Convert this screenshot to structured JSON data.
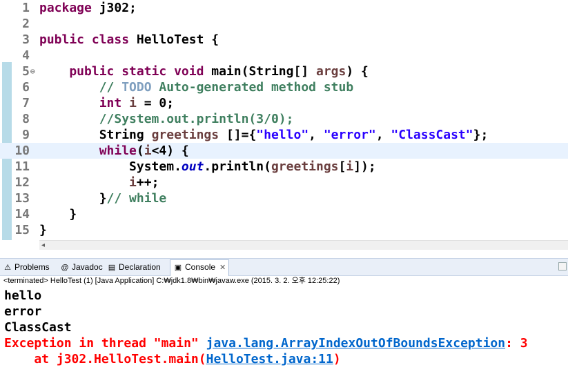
{
  "editor": {
    "lines": [
      {
        "n": "1",
        "tokens": [
          {
            "c": "kw",
            "t": "package"
          },
          {
            "c": "plain",
            "t": " j302;"
          }
        ]
      },
      {
        "n": "2",
        "tokens": []
      },
      {
        "n": "3",
        "tokens": [
          {
            "c": "kw",
            "t": "public class"
          },
          {
            "c": "plain",
            "t": " HelloTest {"
          }
        ]
      },
      {
        "n": "4",
        "tokens": []
      },
      {
        "n": "5",
        "fold": "⊖",
        "tokens": [
          {
            "c": "kw",
            "t": "    public static void"
          },
          {
            "c": "plain",
            "t": " main(String[] "
          },
          {
            "c": "var",
            "t": "args"
          },
          {
            "c": "plain",
            "t": ") {"
          }
        ]
      },
      {
        "n": "6",
        "tokens": [
          {
            "c": "cm",
            "t": "        // "
          },
          {
            "c": "todo",
            "t": "TODO"
          },
          {
            "c": "cm",
            "t": " Auto-generated method stub"
          }
        ]
      },
      {
        "n": "7",
        "tokens": [
          {
            "c": "kw",
            "t": "        int"
          },
          {
            "c": "plain",
            "t": " "
          },
          {
            "c": "var",
            "t": "i"
          },
          {
            "c": "plain",
            "t": " = 0;"
          }
        ]
      },
      {
        "n": "8",
        "tokens": [
          {
            "c": "cm",
            "t": "        //System.out.println(3/0);"
          }
        ]
      },
      {
        "n": "9",
        "tokens": [
          {
            "c": "plain",
            "t": "        String "
          },
          {
            "c": "var",
            "t": "greetings"
          },
          {
            "c": "plain",
            "t": " []={"
          },
          {
            "c": "str",
            "t": "\"hello\""
          },
          {
            "c": "plain",
            "t": ", "
          },
          {
            "c": "str",
            "t": "\"error\""
          },
          {
            "c": "plain",
            "t": ", "
          },
          {
            "c": "str",
            "t": "\"ClassCast\""
          },
          {
            "c": "plain",
            "t": "};"
          }
        ]
      },
      {
        "n": "10",
        "current": true,
        "tokens": [
          {
            "c": "kw",
            "t": "        while"
          },
          {
            "c": "plain",
            "t": "("
          },
          {
            "c": "var",
            "t": "i"
          },
          {
            "c": "plain",
            "t": "<4) {"
          }
        ]
      },
      {
        "n": "11",
        "tokens": [
          {
            "c": "plain",
            "t": "            System."
          },
          {
            "c": "field",
            "t": "out"
          },
          {
            "c": "plain",
            "t": ".println("
          },
          {
            "c": "var",
            "t": "greetings"
          },
          {
            "c": "plain",
            "t": "["
          },
          {
            "c": "var",
            "t": "i"
          },
          {
            "c": "plain",
            "t": "]);"
          }
        ]
      },
      {
        "n": "12",
        "tokens": [
          {
            "c": "var",
            "t": "            i"
          },
          {
            "c": "plain",
            "t": "++;"
          }
        ]
      },
      {
        "n": "13",
        "tokens": [
          {
            "c": "plain",
            "t": "        }"
          },
          {
            "c": "cm",
            "t": "// while"
          }
        ]
      },
      {
        "n": "14",
        "tokens": [
          {
            "c": "plain",
            "t": "    }"
          }
        ]
      },
      {
        "n": "15",
        "tokens": [
          {
            "c": "plain",
            "t": "}"
          }
        ]
      }
    ]
  },
  "views": {
    "tabs": [
      {
        "id": "problems",
        "icon": "problems-icon",
        "glyph": "⚠",
        "label": "Problems"
      },
      {
        "id": "javadoc",
        "icon": "javadoc-icon",
        "glyph": "@",
        "label": "Javadoc"
      },
      {
        "id": "declaration",
        "icon": "declaration-icon",
        "glyph": "▤",
        "label": "Declaration"
      },
      {
        "id": "console",
        "icon": "console-icon",
        "glyph": "▣",
        "label": "Console",
        "active": true,
        "close": "✕"
      }
    ]
  },
  "console": {
    "status": "<terminated> HelloTest (1) [Java Application] C:₩jdk1.8₩bin₩javaw.exe (2015. 3. 2. 오후 12:25:22)",
    "output": [
      {
        "style": "plain",
        "parts": [
          {
            "c": "plain",
            "t": "hello"
          }
        ]
      },
      {
        "style": "plain",
        "parts": [
          {
            "c": "plain",
            "t": "error"
          }
        ]
      },
      {
        "style": "plain",
        "parts": [
          {
            "c": "plain",
            "t": "ClassCast"
          }
        ]
      },
      {
        "style": "err",
        "parts": [
          {
            "c": "err",
            "t": "Exception in thread \"main\" "
          },
          {
            "c": "link",
            "t": "java.lang.ArrayIndexOutOfBoundsException"
          },
          {
            "c": "err",
            "t": ": 3"
          }
        ]
      },
      {
        "style": "err",
        "parts": [
          {
            "c": "err",
            "t": "    at j302.HelloTest.main("
          },
          {
            "c": "link",
            "t": "HelloTest.java:11"
          },
          {
            "c": "err",
            "t": ")"
          }
        ]
      }
    ]
  }
}
